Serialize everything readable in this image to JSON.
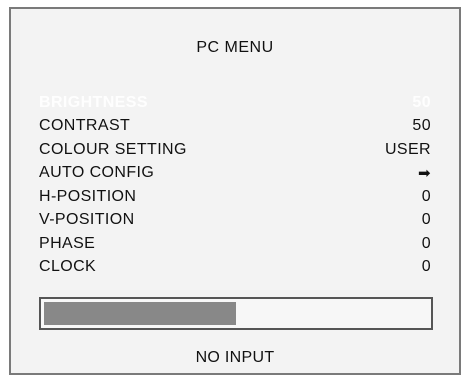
{
  "menu": {
    "title": "PC MENU",
    "items": [
      {
        "label": "BRIGHTNESS",
        "value": "50",
        "selected": true
      },
      {
        "label": "CONTRAST",
        "value": "50"
      },
      {
        "label": "COLOUR SETTING",
        "value": "USER"
      },
      {
        "label": "AUTO CONFIG",
        "value": "➡",
        "icon": "right-arrow-icon"
      },
      {
        "label": "H-POSITION",
        "value": "0"
      },
      {
        "label": "V-POSITION",
        "value": "0"
      },
      {
        "label": "PHASE",
        "value": "0"
      },
      {
        "label": "CLOCK",
        "value": "0"
      }
    ]
  },
  "progress": {
    "percent": 50
  },
  "status": {
    "text": "NO INPUT"
  },
  "colors": {
    "background": "#f3f3f3",
    "border": "#7a7a7a",
    "selected_text": "#ffffff",
    "progress_fill": "#888888"
  }
}
